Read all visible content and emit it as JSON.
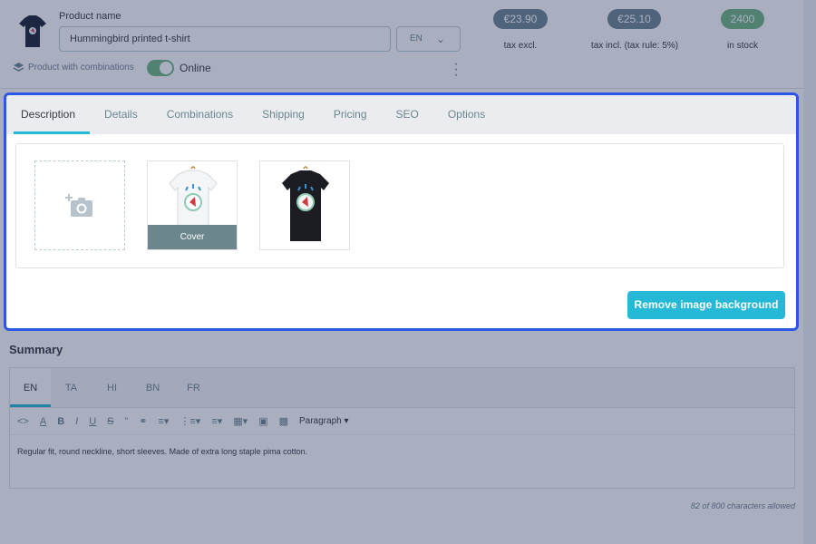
{
  "header": {
    "product_name_label": "Product name",
    "product_name_value": "Hummingbird printed t-shirt",
    "lang": "EN",
    "combinations_label": "Product with combinations",
    "status_label": "Online",
    "prices": [
      {
        "value": "€23.90",
        "caption": "tax excl.",
        "color": "#6c868e"
      },
      {
        "value": "€25.10",
        "caption": "tax incl. (tax rule: 5%)",
        "color": "#6c868e"
      },
      {
        "value": "2400",
        "caption": "in stock",
        "color": "#70b580"
      }
    ]
  },
  "tabs": [
    "Description",
    "Details",
    "Combinations",
    "Shipping",
    "Pricing",
    "SEO",
    "Options"
  ],
  "images": {
    "add_icon": "add-photo-icon",
    "cover_label": "Cover"
  },
  "remove_bg_label": "Remove image background",
  "summary": {
    "title": "Summary",
    "langs": [
      "EN",
      "TA",
      "HI",
      "BN",
      "FR"
    ],
    "paragraph_label": "Paragraph",
    "text": "Regular fit, round neckline, short sleeves. Made of extra long staple pima cotton.",
    "char_count": "82 of 800 characters allowed"
  },
  "colors": {
    "accent": "#25b9d7",
    "highlight_border": "#2c57e6",
    "online_green": "#70b580"
  }
}
